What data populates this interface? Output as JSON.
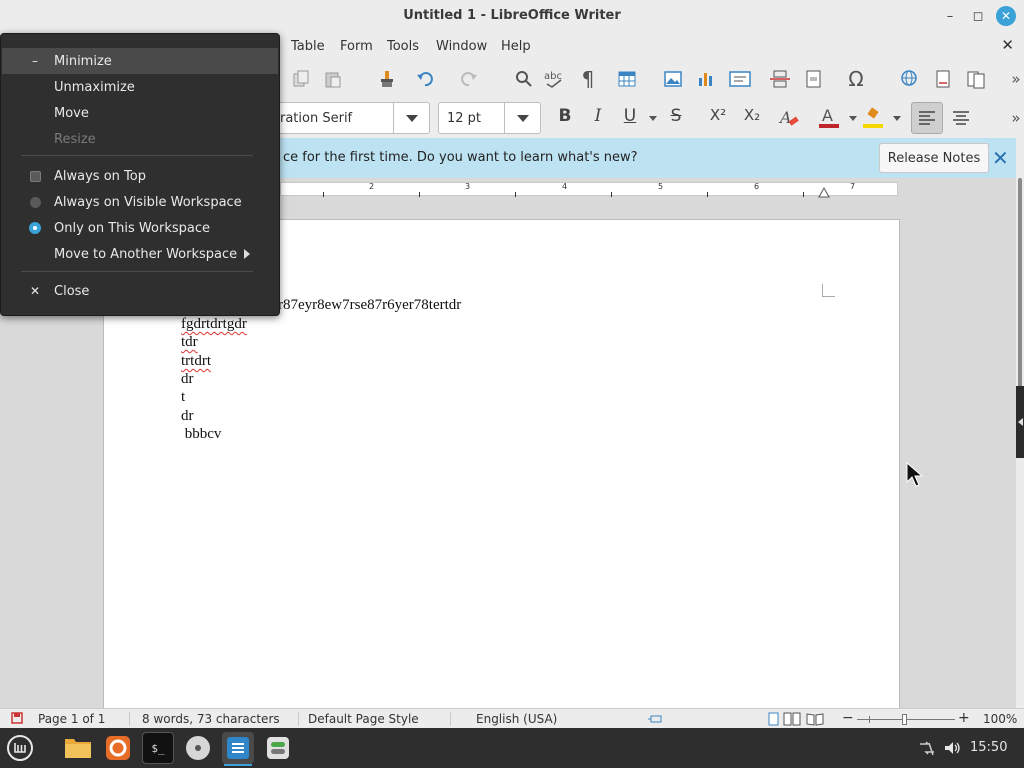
{
  "window": {
    "title": "Untitled 1 - LibreOffice Writer",
    "minimize_glyph": "–",
    "maximize_glyph": "◻",
    "close_glyph": "✕"
  },
  "menubar": {
    "items": [
      "Table",
      "Form",
      "Tools",
      "Window",
      "Help"
    ],
    "close_doc_glyph": "✕"
  },
  "toolbar": {
    "font_name": "ration Serif",
    "font_size": "12 pt",
    "bold": "B",
    "italic": "I",
    "underline": "U",
    "strikethrough": "S",
    "superscript": "X²",
    "subscript": "X₂"
  },
  "infobar": {
    "message": "ce for the first time. Do you want to learn what's new?",
    "release_notes_label": "Release Notes",
    "close_glyph": "✕"
  },
  "ruler": {
    "labels": [
      "2",
      "3",
      "4",
      "5",
      "6",
      "7"
    ]
  },
  "document": {
    "lines": [
      {
        "text": "r87eyr8ew7rse87r6yer78tertdr",
        "misspelled": false
      },
      {
        "text": "fgdrtdrtgdr",
        "misspelled": true
      },
      {
        "text": "tdr",
        "misspelled": true
      },
      {
        "text": "trtdrt",
        "misspelled": true
      },
      {
        "text": "dr",
        "misspelled": false
      },
      {
        "text": "t",
        "misspelled": false
      },
      {
        "text": "dr",
        "misspelled": false
      },
      {
        "text": " bbbcv",
        "misspelled": false
      }
    ]
  },
  "window_menu": {
    "items": [
      {
        "label": "Minimize",
        "lead": "–",
        "kind": "text",
        "hover": true,
        "disabled": false
      },
      {
        "label": "Unmaximize",
        "lead": "",
        "kind": "none",
        "hover": false,
        "disabled": false
      },
      {
        "label": "Move",
        "lead": "",
        "kind": "none",
        "hover": false,
        "disabled": false
      },
      {
        "label": "Resize",
        "lead": "",
        "kind": "none",
        "hover": false,
        "disabled": true
      },
      {
        "label": "Always on Top",
        "lead": "",
        "kind": "checkbox",
        "checked": false
      },
      {
        "label": "Always on Visible Workspace",
        "lead": "",
        "kind": "radio",
        "checked": false
      },
      {
        "label": "Only on This Workspace",
        "lead": "",
        "kind": "radio",
        "checked": true
      },
      {
        "label": "Move to Another Workspace",
        "lead": "",
        "kind": "submenu"
      },
      {
        "label": "Close",
        "lead": "✕",
        "kind": "text"
      }
    ]
  },
  "statusbar": {
    "page": "Page 1 of 1",
    "word_count": "8 words, 73 characters",
    "page_style": "Default Page Style",
    "language": "English (USA)",
    "zoom_minus": "−",
    "zoom_plus": "+",
    "zoom": "100%"
  },
  "taskbar": {
    "terminal_prompt": "$_",
    "clock": "15:50"
  },
  "colors": {
    "accent": "#3aa2d8",
    "infobar_bg": "#bde3f3",
    "menu_bg": "#2f2f2f",
    "taskbar_bg": "#2e2e2e",
    "spell_underline": "#d33"
  }
}
